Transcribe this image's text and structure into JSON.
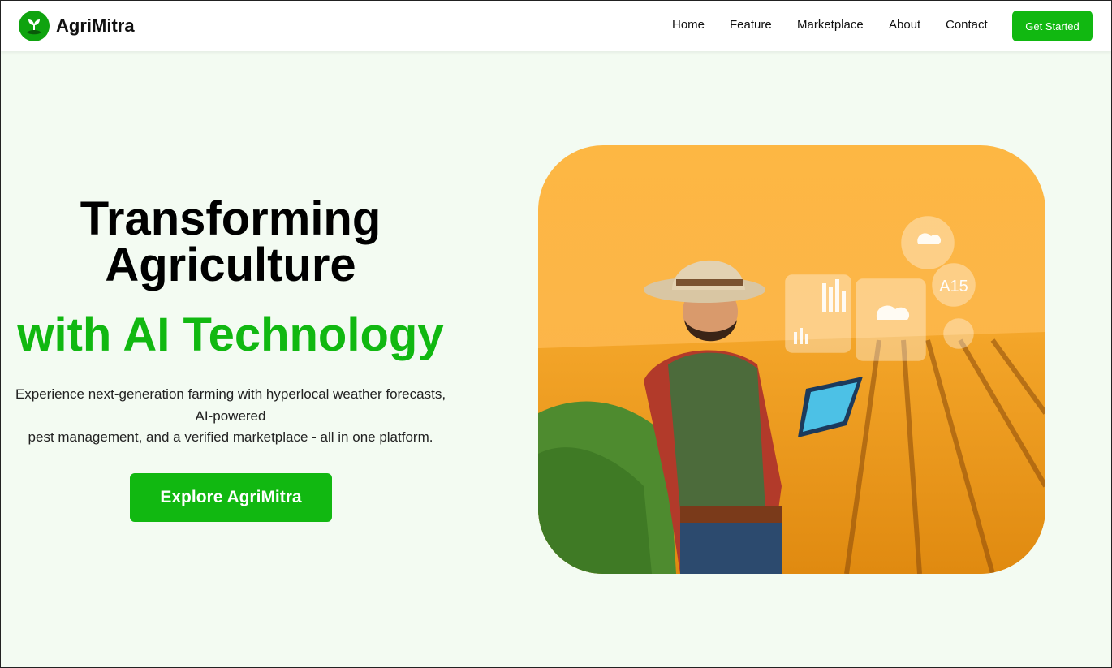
{
  "brand": {
    "name": "AgriMitra",
    "logo_icon": "sprout-icon",
    "accent": "#11b811"
  },
  "nav": {
    "items": [
      {
        "label": "Home"
      },
      {
        "label": "Feature"
      },
      {
        "label": "Marketplace"
      },
      {
        "label": "About"
      },
      {
        "label": "Contact"
      }
    ],
    "cta_label": "Get Started"
  },
  "hero": {
    "title_line1": "Transforming",
    "title_line2": "Agriculture",
    "title_highlight": "with AI Technology",
    "description_lines": [
      "Experience next-generation farming with hyperlocal weather forecasts,",
      "AI-powered",
      "pest management, and a verified marketplace - all in one platform."
    ],
    "button_label": "Explore AgriMitra"
  },
  "image_overlay": {
    "badge_text": "A15"
  }
}
